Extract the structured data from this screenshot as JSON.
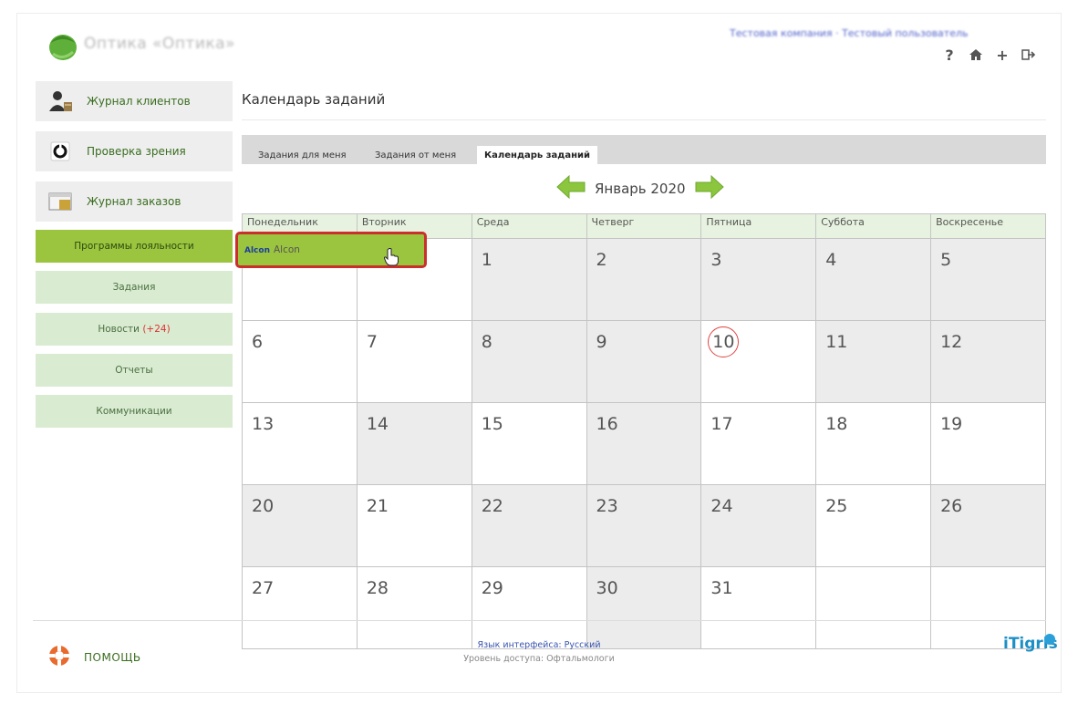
{
  "header": {
    "shop_name": "Оптика «Оптика»",
    "company_line": "Тестовая компания · Тестовый пользователь",
    "icons": [
      "help-icon",
      "home-icon",
      "plus-icon",
      "logout-icon"
    ],
    "help_glyph": "?",
    "plus_glyph": "+"
  },
  "sidebar": {
    "items": [
      {
        "label": "Журнал клиентов",
        "icon": "clients-icon"
      },
      {
        "label": "Проверка зрения",
        "icon": "vision-check-icon"
      },
      {
        "label": "Журнал заказов",
        "icon": "orders-icon"
      },
      {
        "label": "Программы лояльности"
      },
      {
        "label": "Задания"
      },
      {
        "label": "Новости",
        "badge": "(+24)"
      },
      {
        "label": "Отчеты"
      },
      {
        "label": "Коммуникации"
      }
    ],
    "active_index": 3
  },
  "main": {
    "title": "Календарь заданий",
    "tabs": [
      {
        "label": "Задания для меня"
      },
      {
        "label": "Задания от меня"
      },
      {
        "label": "Календарь заданий"
      }
    ],
    "active_tab": 2,
    "month": "Январь 2020",
    "weekdays": [
      "Понедельник",
      "Вторник",
      "Среда",
      "Четверг",
      "Пятница",
      "Суббота",
      "Воскресенье"
    ],
    "weeks": [
      [
        "",
        "",
        "1",
        "2",
        "3",
        "4",
        "5"
      ],
      [
        "6",
        "7",
        "8",
        "9",
        "10",
        "11",
        "12"
      ],
      [
        "13",
        "14",
        "15",
        "16",
        "17",
        "18",
        "19"
      ],
      [
        "20",
        "21",
        "22",
        "23",
        "24",
        "25",
        "26"
      ],
      [
        "27",
        "28",
        "29",
        "30",
        "31",
        "",
        ""
      ]
    ],
    "today": "10",
    "event": {
      "brand": "Alcon",
      "name": "Alcon"
    }
  },
  "footer": {
    "help_label": "ПОМОЩЬ",
    "language_line": "Язык интерфейса: Русский",
    "access_line": "Уровень доступа: Офтальмологи",
    "brand": "iTigris"
  },
  "colors": {
    "accent_green": "#9bc43f",
    "light_green": "#d9ecd2",
    "today_ring": "#e04040",
    "event_border": "#c9302c"
  }
}
